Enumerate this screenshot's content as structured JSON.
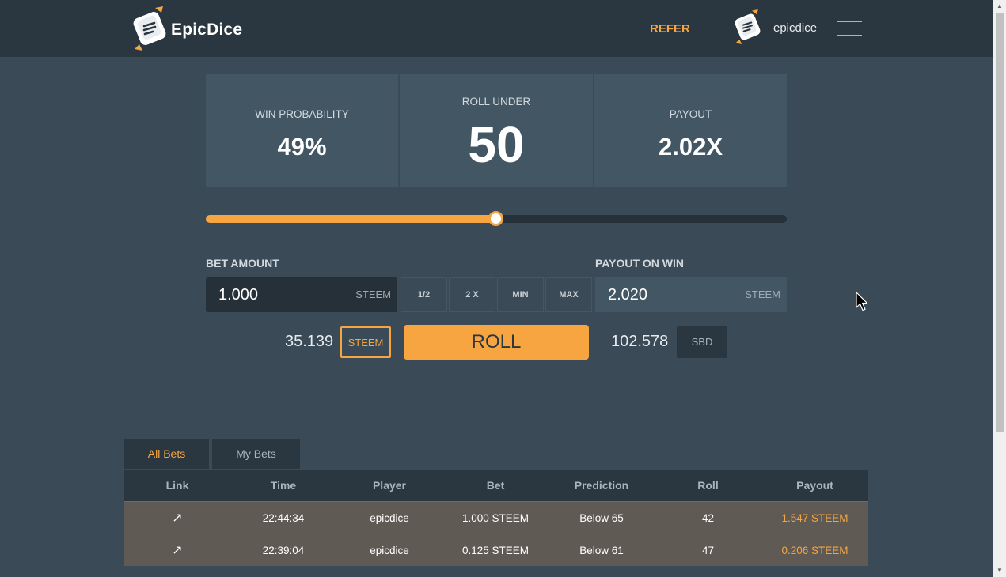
{
  "header": {
    "brand": "EpicDice",
    "refer_label": "REFER",
    "username": "epicdice",
    "accent_color": "#f7a540"
  },
  "stats": {
    "win_probability": {
      "label": "WIN PROBABILITY",
      "value": "49%"
    },
    "roll_under": {
      "label": "ROLL UNDER",
      "value": "50"
    },
    "payout": {
      "label": "PAYOUT",
      "value": "2.02X"
    }
  },
  "slider": {
    "value": 50,
    "min": 0,
    "max": 100
  },
  "bet": {
    "label": "BET AMOUNT",
    "value": "1.000",
    "unit": "STEEM",
    "buttons": [
      "1/2",
      "2 X",
      "MIN",
      "MAX"
    ]
  },
  "payout_on_win": {
    "label": "PAYOUT ON WIN",
    "value": "2.020",
    "unit": "STEEM"
  },
  "balances": {
    "steem_amount": "35.139",
    "steem_label": "STEEM",
    "sbd_amount": "102.578",
    "sbd_label": "SBD"
  },
  "roll_label": "ROLL",
  "tabs": [
    "All Bets",
    "My Bets"
  ],
  "table": {
    "headers": [
      "Link",
      "Time",
      "Player",
      "Bet",
      "Prediction",
      "Roll",
      "Payout"
    ],
    "rows": [
      {
        "link": "↗",
        "time": "22:44:34",
        "player": "epicdice",
        "bet": "1.000 STEEM",
        "prediction": "Below 65",
        "roll": "42",
        "payout": "1.547 STEEM"
      },
      {
        "link": "↗",
        "time": "22:39:04",
        "player": "epicdice",
        "bet": "0.125 STEEM",
        "prediction": "Below 61",
        "roll": "47",
        "payout": "0.206 STEEM"
      }
    ]
  }
}
